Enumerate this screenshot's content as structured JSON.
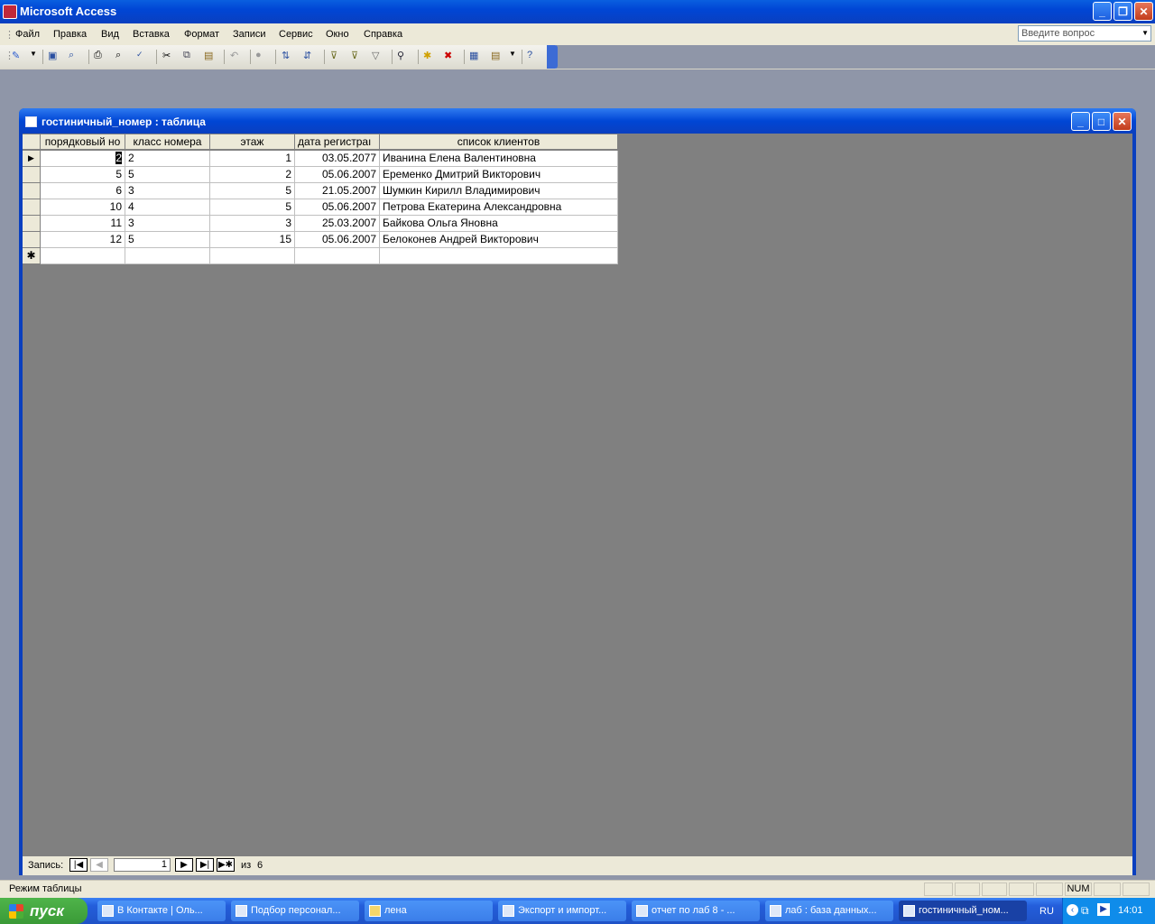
{
  "app": {
    "title": "Microsoft Access"
  },
  "menu": {
    "items": [
      "Файл",
      "Правка",
      "Вид",
      "Вставка",
      "Формат",
      "Записи",
      "Сервис",
      "Окно",
      "Справка"
    ]
  },
  "help_box": {
    "placeholder": "Введите вопрос"
  },
  "table_window": {
    "title": "гостиничный_номер : таблица",
    "columns": [
      "порядковый но",
      "класс номера",
      "этаж",
      "дата регистраı",
      "список клиентов"
    ],
    "rows": [
      [
        "2",
        "2",
        "1",
        "03.05.2077",
        "Иванина Елена Валентиновна"
      ],
      [
        "5",
        "5",
        "2",
        "05.06.2007",
        "Еременко Дмитрий Викторович"
      ],
      [
        "6",
        "3",
        "5",
        "21.05.2007",
        "Шумкин Кирилл Владимирович"
      ],
      [
        "10",
        "4",
        "5",
        "05.06.2007",
        "Петрова Екатерина Александровна"
      ],
      [
        "11",
        "3",
        "3",
        "25.03.2007",
        "Байкова Ольга Яновна"
      ],
      [
        "12",
        "5",
        "15",
        "05.06.2007",
        "Белоконев Андрей Викторович"
      ]
    ],
    "new_row_marker": "✱",
    "current_row_marker": "▶"
  },
  "record_nav": {
    "label": "Запись:",
    "current": "1",
    "of_label": "из",
    "total": "6"
  },
  "status": {
    "text": "Режим таблицы",
    "num": "NUM"
  },
  "taskbar": {
    "start_label": "пуск",
    "tasks": [
      "В Контакте | Оль...",
      "Подбор персонал...",
      "лена",
      "Экспорт и импорт...",
      "отчет по лаб 8 - ...",
      "лаб : база данных...",
      "гостиничный_ном..."
    ],
    "lang": "RU",
    "clock": "14:01"
  },
  "colors": {
    "titlebar": "#0046d5",
    "workspace": "#8f96a8",
    "sheet_bg": "#808080",
    "taskbar": "#245edb",
    "start": "#3a9a37"
  }
}
